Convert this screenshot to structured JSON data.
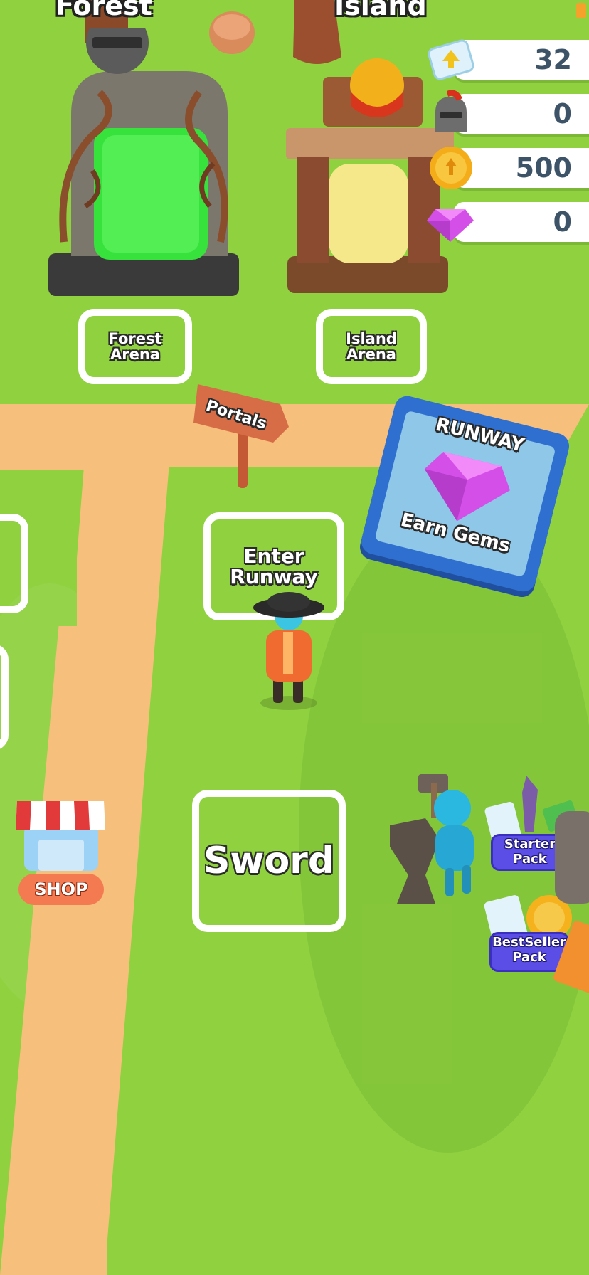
{
  "currencies": {
    "tickets": {
      "value": "32",
      "icon": "ticket-icon"
    },
    "helmets": {
      "value": "0",
      "icon": "knight-helmet-icon"
    },
    "coins": {
      "value": "500",
      "icon": "gold-coin-icon"
    },
    "gems": {
      "value": "0",
      "icon": "pink-gem-icon"
    }
  },
  "portals": {
    "forest": {
      "title": "Forest",
      "pad_label": "Forest Arena"
    },
    "island": {
      "title": "Island",
      "pad_label": "Island Arena"
    }
  },
  "signpost": {
    "label": "Portals"
  },
  "runway": {
    "billboard_title": "RUNWAY",
    "billboard_subtitle": "Earn Gems",
    "pad_label": "Enter Runway"
  },
  "sword_pad": {
    "label": "Sword"
  },
  "shop": {
    "label": "SHOP"
  },
  "packs": {
    "starter": {
      "label": "Starter Pack"
    },
    "bestseller": {
      "label": "BestSeller Pack"
    }
  },
  "colors": {
    "grass": "#8fd13f",
    "path": "#f6c07c",
    "currency_text": "#3d5468",
    "pack_button": "#5b4ee6",
    "runway_board": "#2f6fd0",
    "shop_pill": "#f47a52"
  }
}
